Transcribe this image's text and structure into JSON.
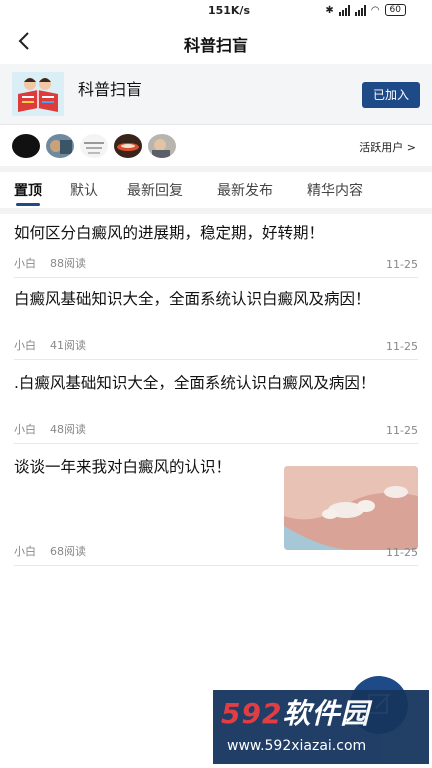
{
  "status_bar": {
    "speed": "151K/s",
    "battery": "60"
  },
  "nav": {
    "title": "科普扫盲"
  },
  "group": {
    "name": "科普扫盲",
    "join_label": "已加入"
  },
  "users": {
    "active_label": "活跃用户 >"
  },
  "tabs": [
    {
      "label": "置顶"
    },
    {
      "label": "默认"
    },
    {
      "label": "最新回复"
    },
    {
      "label": "最新发布"
    },
    {
      "label": "精华内容"
    }
  ],
  "posts": [
    {
      "title": "如何区分白癜风的进展期，稳定期，好转期！",
      "author": "小白",
      "reads": "88阅读",
      "date": "11-25"
    },
    {
      "title": "白癜风基础知识大全，全面系统认识白癜风及病因！",
      "author": "小白",
      "reads": "41阅读",
      "date": "11-25"
    },
    {
      "title": ".白癜风基础知识大全，全面系统认识白癜风及病因！",
      "author": "小白",
      "reads": "48阅读",
      "date": "11-25"
    },
    {
      "title": "谈谈一年来我对白癜风的认识！",
      "author": "小白",
      "reads": "68阅读",
      "date": "11-25"
    }
  ],
  "watermark": {
    "brand_num": "592",
    "brand_text": "软件园",
    "url": "www.592xiazai.com"
  },
  "colors": {
    "accent": "#1e4a87",
    "divider": "#e8e8e8"
  }
}
